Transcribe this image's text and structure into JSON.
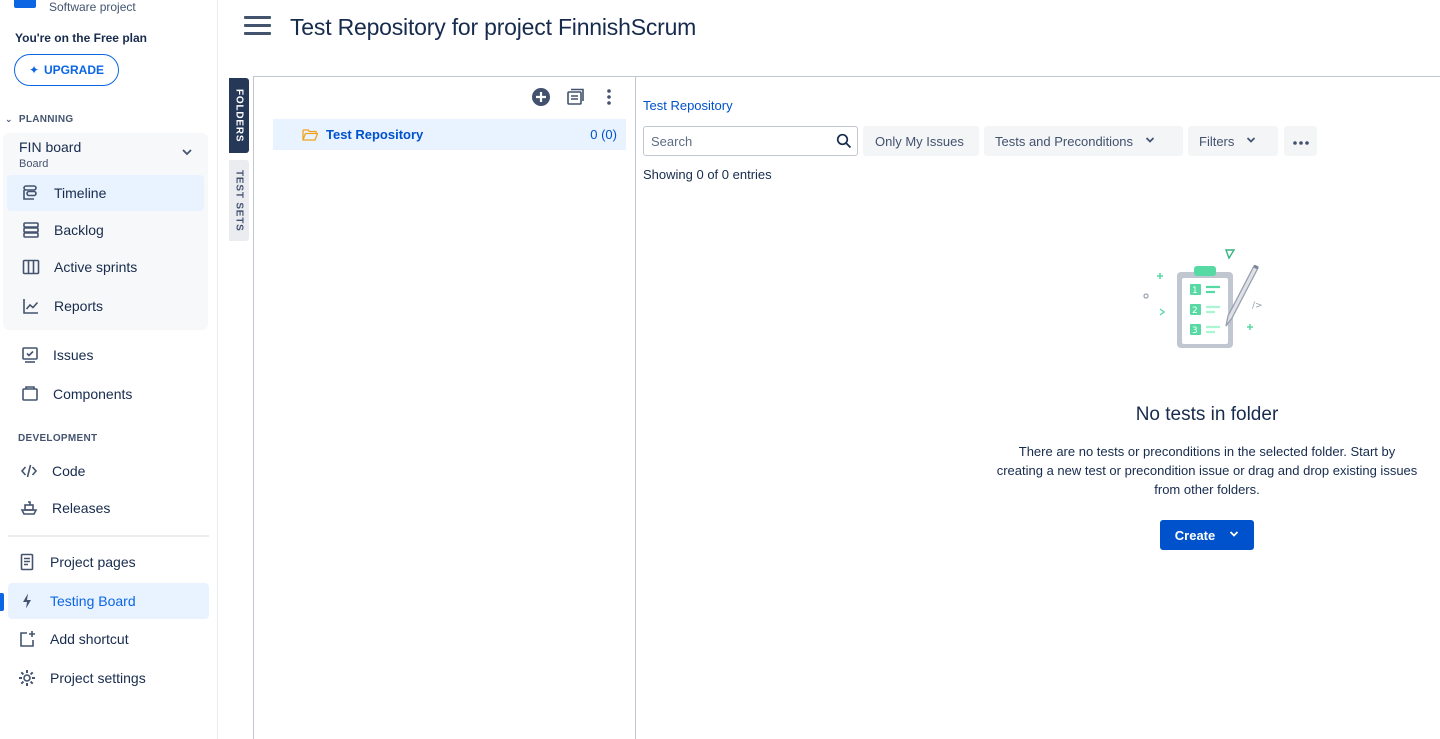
{
  "sidebar": {
    "project_type": "Software project",
    "plan_note": "You're on the Free plan",
    "upgrade_label": "UPGRADE",
    "planning_label": "PLANNING",
    "board": {
      "name": "FIN board",
      "sub": "Board"
    },
    "planning_items": [
      {
        "label": "Timeline",
        "icon": "timeline-icon"
      },
      {
        "label": "Backlog",
        "icon": "backlog-icon"
      },
      {
        "label": "Active sprints",
        "icon": "board-columns-icon"
      },
      {
        "label": "Reports",
        "icon": "chart-line-icon"
      }
    ],
    "other_items": [
      {
        "label": "Issues",
        "icon": "issues-icon"
      },
      {
        "label": "Components",
        "icon": "components-icon"
      }
    ],
    "development_label": "DEVELOPMENT",
    "development_items": [
      {
        "label": "Code",
        "icon": "code-icon"
      },
      {
        "label": "Releases",
        "icon": "ship-icon"
      }
    ],
    "footer_items": [
      {
        "label": "Project pages",
        "icon": "page-icon"
      },
      {
        "label": "Testing Board",
        "icon": "lightning-icon",
        "selected": true
      },
      {
        "label": "Add shortcut",
        "icon": "add-shortcut-icon"
      },
      {
        "label": "Project settings",
        "icon": "gear-icon"
      }
    ]
  },
  "header": {
    "title": "Test Repository for project FinnishScrum"
  },
  "tabs": {
    "folders": "FOLDERS",
    "test_sets": "TEST SETS"
  },
  "folder_tree": {
    "root": {
      "name": "Test Repository",
      "count": "0 (0)"
    }
  },
  "main": {
    "breadcrumb": "Test Repository",
    "search_placeholder": "Search",
    "only_my_issues": "Only My Issues",
    "type_filter": "Tests and Preconditions",
    "filters": "Filters",
    "entries": "Showing 0 of 0 entries",
    "empty_title": "No tests in folder",
    "empty_desc": "There are no tests or preconditions in the selected folder. Start by creating a new test or precondition issue or drag and drop existing issues from other folders.",
    "create_label": "Create"
  },
  "colors": {
    "accent": "#0052cc",
    "selected_bg": "#e9f2ff",
    "tab_dark": "#253858"
  }
}
